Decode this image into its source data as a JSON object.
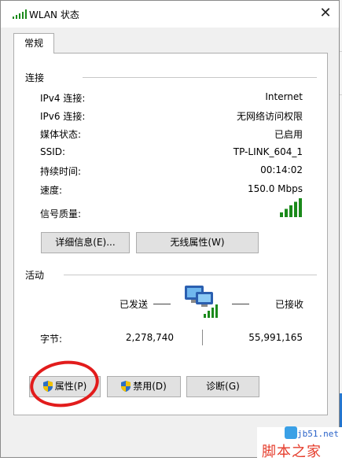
{
  "window": {
    "title": "WLAN 状态",
    "close_glyph": "✕"
  },
  "tabs": [
    {
      "label": "常规",
      "selected": true
    }
  ],
  "connection": {
    "heading": "连接",
    "rows": [
      {
        "label": "IPv4 连接:",
        "value": "Internet"
      },
      {
        "label": "IPv6 连接:",
        "value": "无网络访问权限"
      },
      {
        "label": "媒体状态:",
        "value": "已启用"
      },
      {
        "label": "SSID:",
        "value": "TP-LINK_604_1"
      },
      {
        "label": "持续时间:",
        "value": "00:14:02"
      },
      {
        "label": "速度:",
        "value": "150.0 Mbps"
      }
    ],
    "signal_label": "信号质量:",
    "signal_bars_lit": 5,
    "signal_bars_total": 5,
    "buttons": {
      "details": "详细信息(E)...",
      "wireless": "无线属性(W)"
    }
  },
  "activity": {
    "heading": "活动",
    "sent_label": "已发送",
    "received_label": "已接收",
    "bytes_label": "字节:",
    "bytes_sent": "2,278,740",
    "bytes_received": "55,991,165"
  },
  "actions": {
    "properties": "属性(P)",
    "disable": "禁用(D)",
    "diagnose": "诊断(G)"
  },
  "watermark": {
    "url": "jb51.net",
    "name": "脚本之家"
  },
  "colors": {
    "signal_green": "#1b8a1b",
    "annotation_red": "#e21c1c",
    "shield_blue": "#2d6fc4",
    "shield_yellow": "#f2c200"
  },
  "icons": [
    "wifi-signal-icon",
    "close-icon",
    "network-computers-icon",
    "shield-icon"
  ]
}
